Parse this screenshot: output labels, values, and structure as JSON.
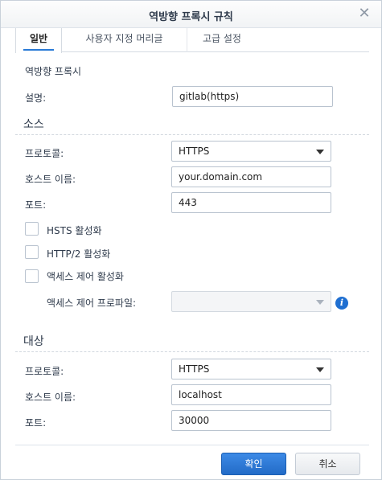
{
  "dialog": {
    "title": "역방향 프록시 규칙"
  },
  "tabs": [
    {
      "label": "일반",
      "active": true
    },
    {
      "label": "사용자 지정 머리글",
      "active": false
    },
    {
      "label": "고급 설정",
      "active": false
    }
  ],
  "general": {
    "rule_label": "역방향 프록시",
    "description_label": "설명:",
    "description_value": "gitlab(https)"
  },
  "source": {
    "section_title": "소스",
    "protocol_label": "프로토콜:",
    "protocol_value": "HTTPS",
    "hostname_label": "호스트 이름:",
    "hostname_value": "your.domain.com",
    "port_label": "포트:",
    "port_value": "443",
    "hsts_label": "HSTS 활성화",
    "hsts_checked": false,
    "http2_label": "HTTP/2 활성화",
    "http2_checked": false,
    "access_control_label": "액세스 제어 활성화",
    "access_control_checked": false,
    "access_profile_label": "액세스 제어 프로파일:",
    "access_profile_value": ""
  },
  "destination": {
    "section_title": "대상",
    "protocol_label": "프로토콜:",
    "protocol_value": "HTTPS",
    "hostname_label": "호스트 이름:",
    "hostname_value": "localhost",
    "port_label": "포트:",
    "port_value": "30000"
  },
  "footer": {
    "ok_label": "확인",
    "cancel_label": "취소"
  },
  "colors": {
    "accent": "#226bc7",
    "info_icon": "#1f6fd1"
  },
  "icons": {
    "close": "close-icon",
    "info": "info-icon",
    "dropdown": "chevron-down-icon"
  }
}
